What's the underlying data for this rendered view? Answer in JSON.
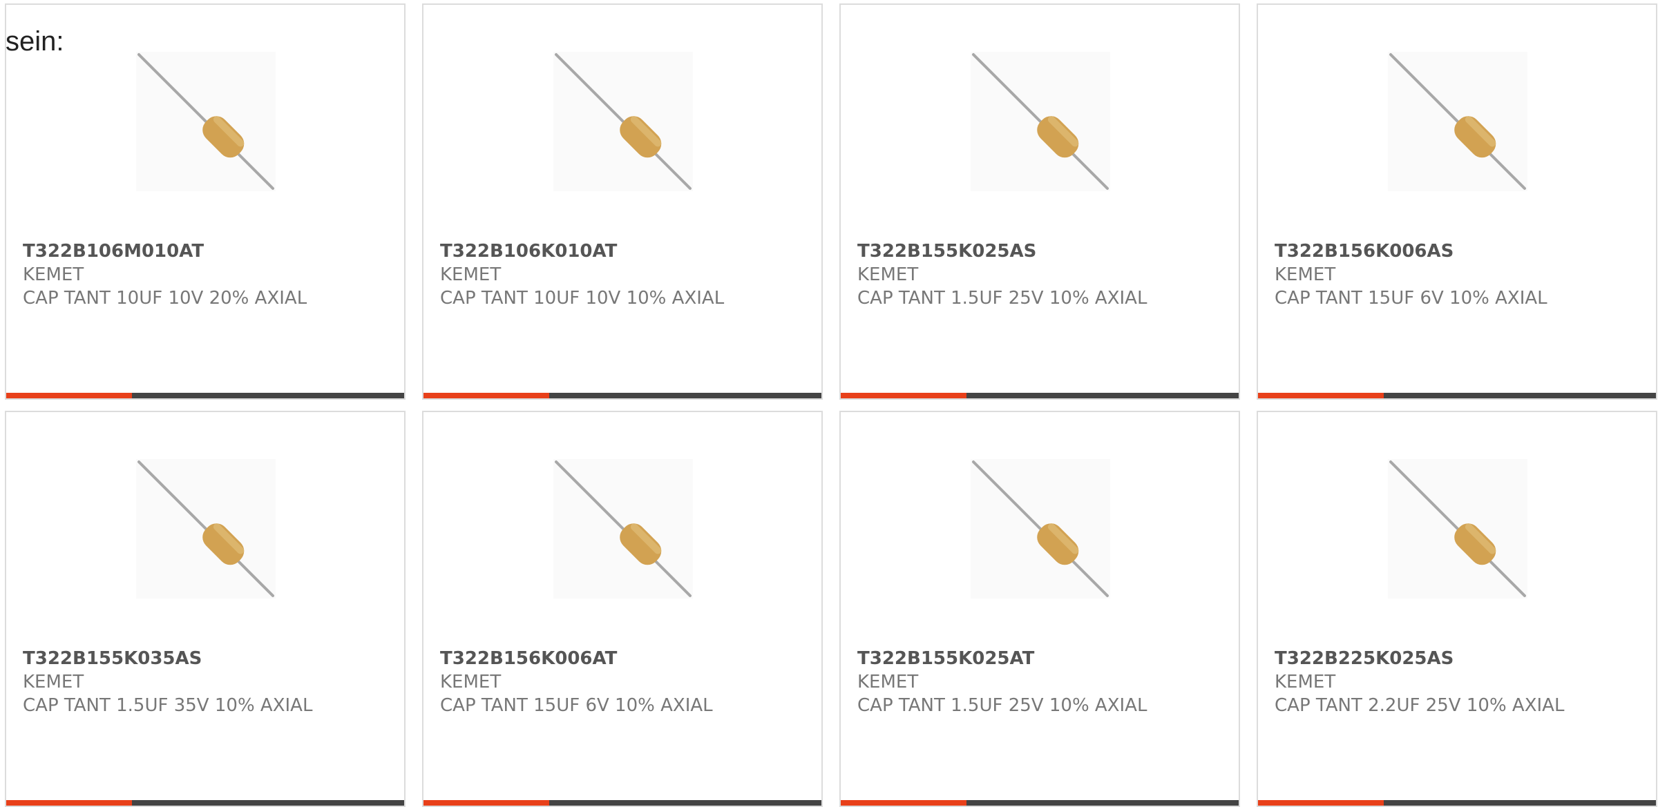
{
  "prefix_text": "sein:",
  "colors": {
    "accent": "#e8401a",
    "bar_dark": "#444444",
    "part_text": "#555555",
    "meta_text": "#777777"
  },
  "products": [
    {
      "part": "T322B106M010AT",
      "manufacturer": "KEMET",
      "description": "CAP TANT 10UF 10V 20% AXIAL",
      "image_icon": "axial-capacitor-icon"
    },
    {
      "part": "T322B106K010AT",
      "manufacturer": "KEMET",
      "description": "CAP TANT 10UF 10V 10% AXIAL",
      "image_icon": "axial-capacitor-icon"
    },
    {
      "part": "T322B155K025AS",
      "manufacturer": "KEMET",
      "description": "CAP TANT 1.5UF 25V 10% AXIAL",
      "image_icon": "axial-capacitor-icon"
    },
    {
      "part": "T322B156K006AS",
      "manufacturer": "KEMET",
      "description": "CAP TANT 15UF 6V 10% AXIAL",
      "image_icon": "axial-capacitor-icon"
    },
    {
      "part": "T322B155K035AS",
      "manufacturer": "KEMET",
      "description": "CAP TANT 1.5UF 35V 10% AXIAL",
      "image_icon": "axial-capacitor-icon"
    },
    {
      "part": "T322B156K006AT",
      "manufacturer": "KEMET",
      "description": "CAP TANT 15UF 6V 10% AXIAL",
      "image_icon": "axial-capacitor-icon"
    },
    {
      "part": "T322B155K025AT",
      "manufacturer": "KEMET",
      "description": "CAP TANT 1.5UF 25V 10% AXIAL",
      "image_icon": "axial-capacitor-icon"
    },
    {
      "part": "T322B225K025AS",
      "manufacturer": "KEMET",
      "description": "CAP TANT 2.2UF 25V 10% AXIAL",
      "image_icon": "axial-capacitor-icon"
    }
  ]
}
